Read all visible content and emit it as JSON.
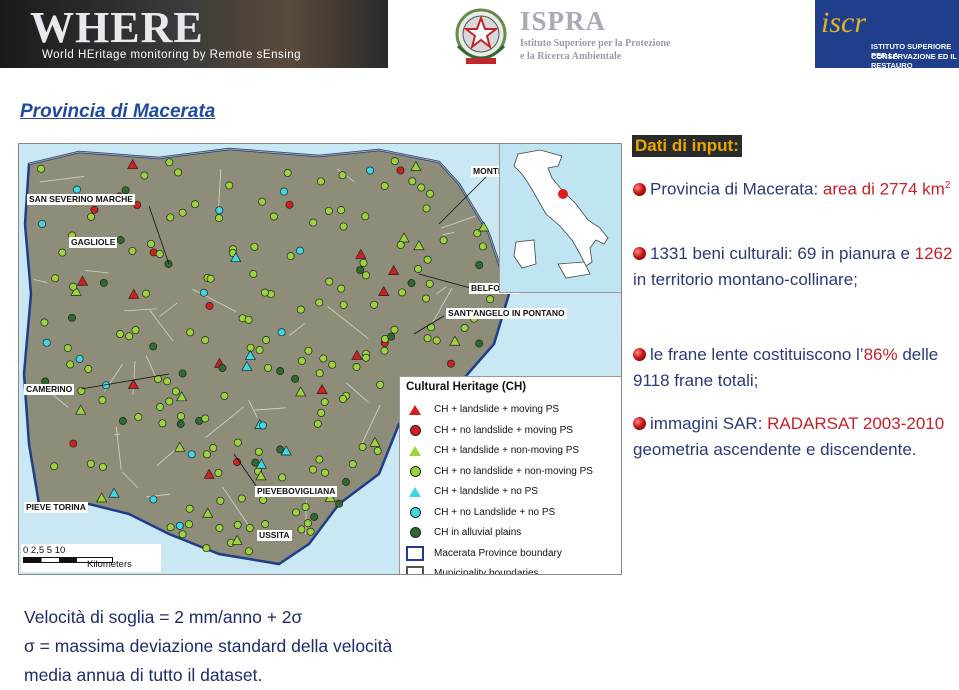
{
  "header": {
    "where_title": "WHERE",
    "where_subtitle": "World HEritage monitoring by Remote sEnsing",
    "ispra_name": "ISPRA",
    "ispra_line1": "Istituto Superiore per la Protezione",
    "ispra_line2": "e la Ricerca Ambientale",
    "iscr_mark": "iscr",
    "iscr_line1": "ISTITUTO SUPERIORE PER LA",
    "iscr_line2": "CONSERVAZIONE ED IL RESTAURO"
  },
  "page_title": "Provincia di Macerata",
  "map": {
    "place_labels": {
      "monte": "MONTE",
      "san_severino": "SAN SEVERINO MARCHE",
      "gagliole": "GAGLIOLE",
      "belforte": "BELFORTE",
      "santangelo": "SANT'ANGELO IN PONTANO",
      "camerino": "CAMERINO",
      "pievebovigliana": "PIEVEBOVIGLIANA",
      "pieve_torina": "PIEVE TORINA",
      "ussita": "USSITA"
    },
    "legend_title": "Cultural Heritage (CH)",
    "legend": [
      {
        "label": "CH + landslide + moving PS",
        "symbol": "triangle",
        "color": "#d11f1f"
      },
      {
        "label": "CH + no landslide + moving PS",
        "symbol": "circle",
        "color": "#d11f1f"
      },
      {
        "label": "CH + landslide + non-moving PS",
        "symbol": "triangle",
        "color": "#9bd43a"
      },
      {
        "label": "CH + no landslide + non-moving PS",
        "symbol": "circle",
        "color": "#9bd43a"
      },
      {
        "label": "CH + landslide + no PS",
        "symbol": "triangle",
        "color": "#3ed7e6"
      },
      {
        "label": "CH + no Landslide + no PS",
        "symbol": "circle",
        "color": "#3ed7e6"
      },
      {
        "label": "CH in alluvial plains",
        "symbol": "circle",
        "color": "#2e6b2e"
      },
      {
        "label": "Macerata Province boundary",
        "symbol": "box",
        "color": "#1f3d8a"
      },
      {
        "label": "Municipality boundaries",
        "symbol": "box",
        "color": "#555555"
      }
    ],
    "scale_ticks": "0 2,5 5      10",
    "scale_unit": "Kilometers"
  },
  "inputs": {
    "title": "Dati di input:",
    "p1_a": "Provincia di Macerata: ",
    "p1_b": "area di 2774 km",
    "p1_sup": "2",
    "p2_a": "1331 beni culturali: 69 in pianura e ",
    "p2_b": "1262",
    "p2_c": " in territorio montano-collinare;",
    "p3_a": "le frane lente costituiscono l’",
    "p3_b": "86%",
    "p3_c": " delle 9118 frane totali;",
    "p4_a": "immagini SAR: ",
    "p4_b": "RADARSAT",
    "p4_c": " 2003-2010",
    "p4_d": " geometria ascendente e discendente."
  },
  "bottom": {
    "line1": "Velocità di soglia = 2 mm/anno + 2σ",
    "line2": "σ  = massima deviazione standard della velocità",
    "line3": "media annua di tutto il dataset."
  },
  "colors": {
    "title_blue": "#1f4aa0",
    "text_navy": "#2a3a7a",
    "highlight_red": "#c8202a",
    "input_title_gold": "#e6a800"
  }
}
